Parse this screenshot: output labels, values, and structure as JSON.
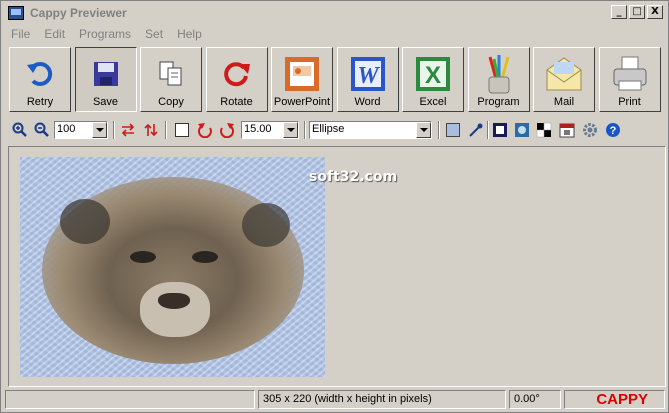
{
  "window": {
    "title": "Cappy Previewer"
  },
  "controls": {
    "minimize": "_",
    "maximize": "□",
    "close": "X"
  },
  "menu": [
    "File",
    "Edit",
    "Programs",
    "Set",
    "Help"
  ],
  "toolbar": [
    {
      "label": "Retry",
      "icon": "retry-icon"
    },
    {
      "label": "Save",
      "icon": "save-icon"
    },
    {
      "label": "Copy",
      "icon": "copy-icon"
    },
    {
      "label": "Rotate",
      "icon": "rotate-icon"
    },
    {
      "label": "PowerPoint",
      "icon": "powerpoint-icon"
    },
    {
      "label": "Word",
      "icon": "word-icon"
    },
    {
      "label": "Excel",
      "icon": "excel-icon"
    },
    {
      "label": "Program",
      "icon": "program-icon"
    },
    {
      "label": "Mail",
      "icon": "mail-icon"
    },
    {
      "label": "Print",
      "icon": "print-icon"
    }
  ],
  "smallbar": {
    "zoom_value": "100",
    "angle_value": "15.00",
    "shape_value": "Ellipse"
  },
  "canvas": {
    "watermark": "soft32.com"
  },
  "status": {
    "dims": "305 x 220   (width x height in pixels)",
    "angle": "0.00°",
    "brand": "CAPPY"
  },
  "colors": {
    "brand": "#e00000",
    "face": "#d4d0c8"
  }
}
